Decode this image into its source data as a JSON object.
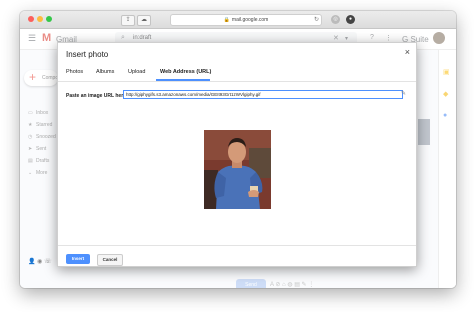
{
  "browser": {
    "url": "mail.google.com",
    "lock_icon": "lock-icon",
    "colors": {
      "close": "#fc605c",
      "minimize": "#fdbc40",
      "maximize": "#34c749"
    }
  },
  "gmail": {
    "logo_text": "Gmail",
    "search_query": "in:draft",
    "brand": "G Suite",
    "compose_label": "Compose",
    "nav": [
      "Inbox",
      "Starred",
      "Snoozed",
      "Sent",
      "Drafts",
      "More"
    ],
    "send_label": "Send"
  },
  "dialog": {
    "title": "Insert photo",
    "tabs": [
      "Photos",
      "Albums",
      "Upload",
      "Web Address (URL)"
    ],
    "active_tab": "Web Address (URL)",
    "url_label": "Paste an image URL here:",
    "url_value": "http://giphygifs.s3.amazonaws.com/media/GEIt93Grt1zWVlgiphy.gif",
    "insert_label": "Insert",
    "cancel_label": "Cancel",
    "accent": "#4d90fe"
  }
}
